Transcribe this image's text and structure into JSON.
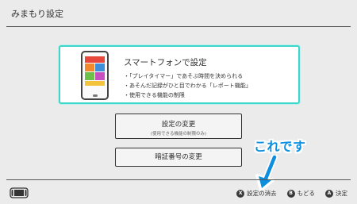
{
  "header": {
    "title": "みまもり設定"
  },
  "card": {
    "title": "スマートフォンで設定",
    "features": [
      "・「プレイタイマー」であそぶ時間を決められる",
      "・あそんだ記録がひと目でわかる「レポート機能」",
      "・使用できる機能の制限"
    ]
  },
  "buttons": {
    "change": {
      "label": "設定の変更",
      "sublabel": "(使用できる機能の制限のみ)"
    },
    "pin": {
      "label": "暗証番号の変更"
    }
  },
  "annotation": {
    "text": "これです",
    "color": "#0d8fe0"
  },
  "footer": {
    "actions": [
      {
        "key": "X",
        "label": "設定の消去"
      },
      {
        "key": "B",
        "label": "もどる"
      },
      {
        "key": "A",
        "label": "決定"
      }
    ]
  },
  "colors": {
    "accent": "#3ed6cb",
    "background": "#ebebeb"
  },
  "icons": {
    "controller": "console-controller-icon",
    "phone": "smartphone-icon",
    "arrow": "arrow-down-icon"
  }
}
